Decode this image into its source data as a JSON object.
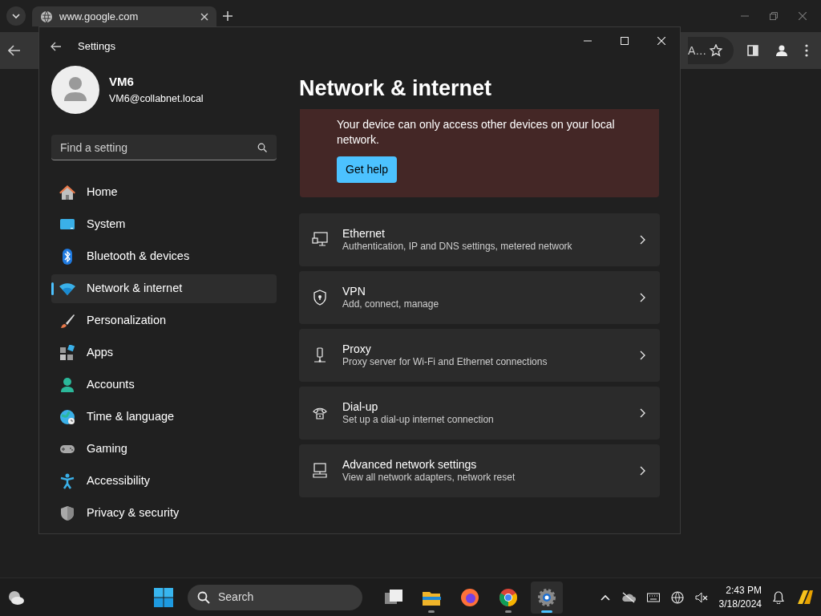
{
  "browser": {
    "tab": {
      "title": "www.google.com"
    },
    "omnibox_text": "A…"
  },
  "window": {
    "title": "Settings"
  },
  "account": {
    "name": "VM6",
    "email": "VM6@collabnet.local"
  },
  "search": {
    "placeholder": "Find a setting"
  },
  "sidebar": {
    "items": [
      {
        "label": "Home",
        "selected": false
      },
      {
        "label": "System",
        "selected": false
      },
      {
        "label": "Bluetooth & devices",
        "selected": false
      },
      {
        "label": "Network & internet",
        "selected": true
      },
      {
        "label": "Personalization",
        "selected": false
      },
      {
        "label": "Apps",
        "selected": false
      },
      {
        "label": "Accounts",
        "selected": false
      },
      {
        "label": "Time & language",
        "selected": false
      },
      {
        "label": "Gaming",
        "selected": false
      },
      {
        "label": "Accessibility",
        "selected": false
      },
      {
        "label": "Privacy & security",
        "selected": false
      }
    ]
  },
  "page": {
    "title": "Network & internet",
    "banner": {
      "text": "Your device can only access other devices on your local network.",
      "button": "Get help"
    },
    "rows": [
      {
        "title": "Ethernet",
        "subtitle": "Authentication, IP and DNS settings, metered network"
      },
      {
        "title": "VPN",
        "subtitle": "Add, connect, manage"
      },
      {
        "title": "Proxy",
        "subtitle": "Proxy server for Wi-Fi and Ethernet connections"
      },
      {
        "title": "Dial-up",
        "subtitle": "Set up a dial-up internet connection"
      },
      {
        "title": "Advanced network settings",
        "subtitle": "View all network adapters, network reset"
      }
    ]
  },
  "taskbar": {
    "search_label": "Search",
    "apps": [
      {
        "running": false,
        "active": false
      },
      {
        "running": true,
        "active": false
      },
      {
        "running": false,
        "active": false
      },
      {
        "running": true,
        "active": false
      },
      {
        "running": true,
        "active": true
      }
    ],
    "time": "2:43 PM",
    "date": "3/18/2024"
  }
}
